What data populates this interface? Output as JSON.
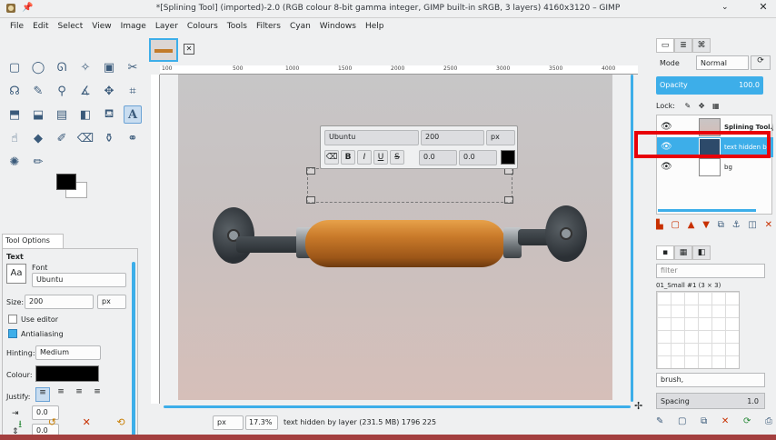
{
  "window": {
    "title": "*[Splining Tool] (imported)-2.0 (RGB colour 8-bit gamma integer, GIMP built-in sRGB, 3 layers) 4160x3120 – GIMP",
    "close_glyph": "✕",
    "pin_glyph": "📌",
    "menu_glyph": "⌄"
  },
  "menu": [
    "File",
    "Edit",
    "Select",
    "View",
    "Image",
    "Layer",
    "Colours",
    "Tools",
    "Filters",
    "Cyan",
    "Windows",
    "Help"
  ],
  "tool_options": {
    "tab_label": "Tool Options",
    "section": "Text",
    "font_label": "Font",
    "font_icon_text": "Aa",
    "font_value": "Ubuntu",
    "size_label": "Size:",
    "size_value": "200",
    "size_unit": "px",
    "use_editor_label": "Use editor",
    "antialiasing_label": "Antialiasing",
    "hinting_label": "Hinting:",
    "hinting_value": "Medium",
    "colour_label": "Colour:",
    "justify_label": "Justify:",
    "indent_value": "0.0",
    "line_spacing_value": "0.0",
    "letter_spacing_prefix": "Ab",
    "colors": {
      "foreground": "#000000",
      "background": "#ffffff"
    }
  },
  "text_toolbar": {
    "font": "Ubuntu",
    "size": "200",
    "unit": "px",
    "bold": "B",
    "italic": "I",
    "underline": "U",
    "strike": "S",
    "baseline": "0.0",
    "kerning": "0.0"
  },
  "ruler_ticks": [
    "100",
    "500",
    "1000",
    "1500",
    "2000",
    "2500",
    "3000",
    "3500",
    "4000"
  ],
  "status": {
    "unit": "px",
    "zoom": "17.3%",
    "message": "text hidden by layer (231.5 MB) 1796 225"
  },
  "layers_panel": {
    "mode_label": "Mode",
    "mode_value": "Normal",
    "opacity_label": "Opacity",
    "opacity_value": "100.0",
    "lock_label": "Lock:",
    "layers": [
      {
        "name": "Splining Tool.j",
        "visible": true
      },
      {
        "name": "text hidden by",
        "visible": true
      },
      {
        "name": "bg",
        "visible": true
      }
    ]
  },
  "brushes_panel": {
    "filter_placeholder": "filter",
    "brush_name": "01_Small #1 (3 × 3)",
    "tag_value": "brush,",
    "spacing_label": "Spacing",
    "spacing_value": "1.0"
  },
  "accent_color": "#3daee9",
  "highlight_color": "#e8000a"
}
